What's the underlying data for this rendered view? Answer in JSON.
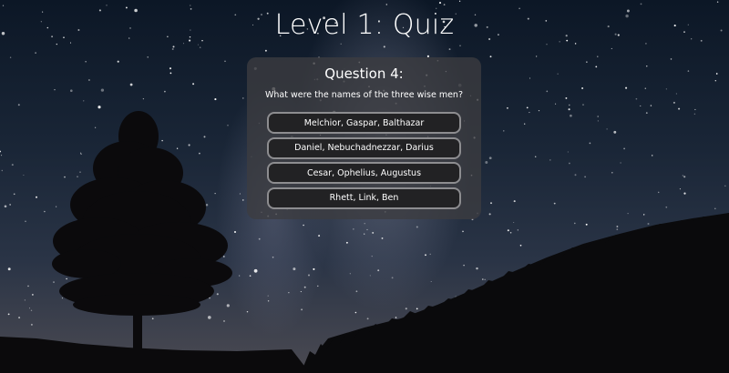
{
  "page": {
    "title": "Level 1: Quiz"
  },
  "quiz": {
    "question_heading": "Question 4:",
    "question_text": "What were the names of the three wise men?",
    "answers": [
      "Melchior, Gaspar, Balthazar",
      "Daniel, Nebuchadnezzar, Darius",
      "Cesar, Ophelius, Augustus",
      "Rhett, Link, Ben"
    ]
  },
  "colors": {
    "panel_background": "#3c3c40",
    "button_background": "#222224",
    "button_border": "#8d8d90",
    "text": "#ffffff"
  }
}
